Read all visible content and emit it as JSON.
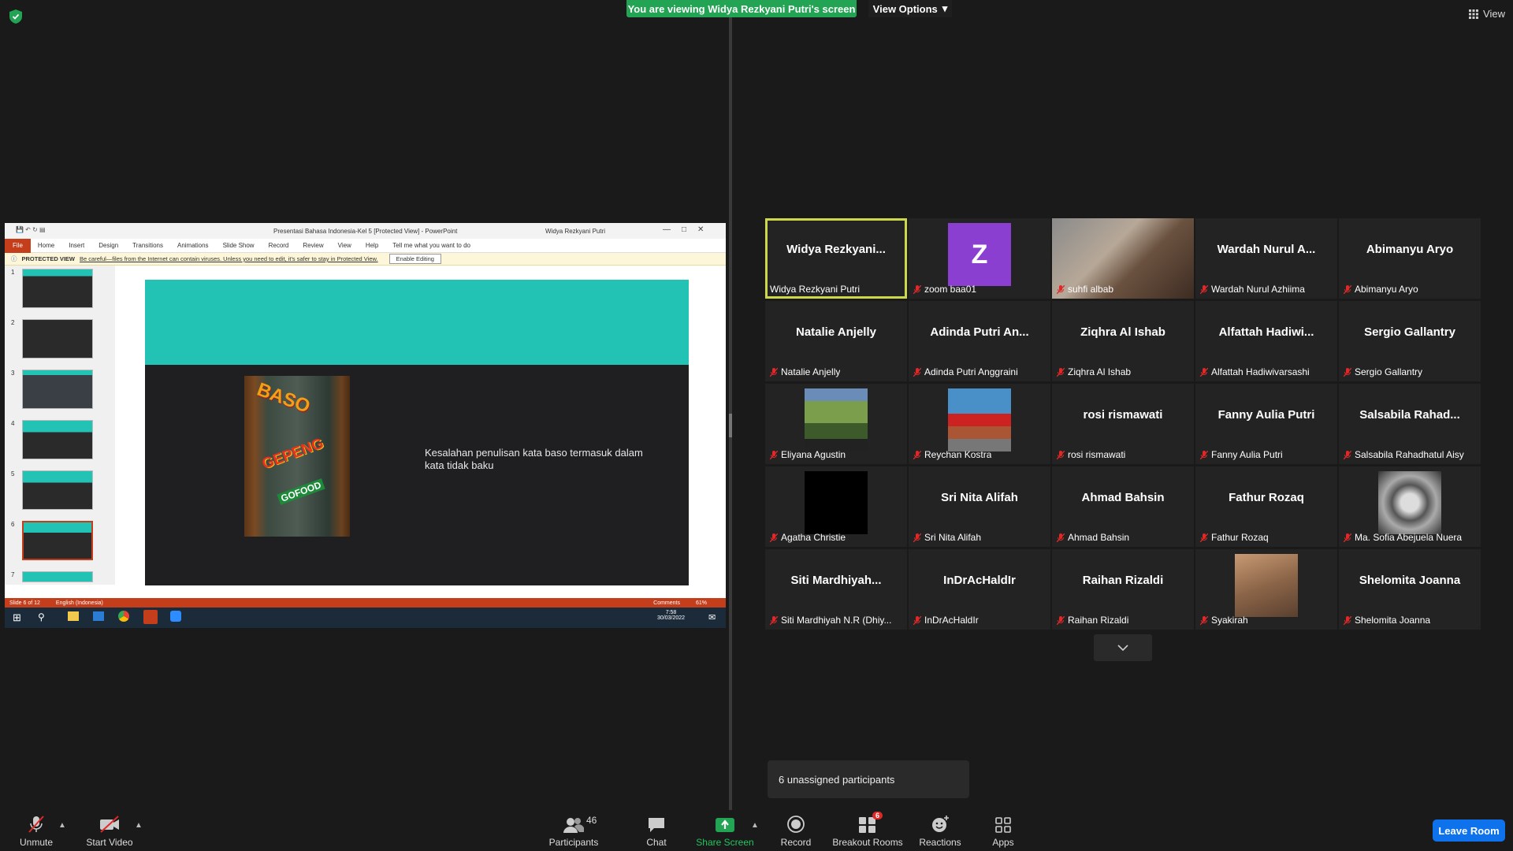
{
  "banner": {
    "sharing_text": "You are viewing Widya Rezkyani Putri's screen",
    "view_options_label": "View Options"
  },
  "view_button": {
    "label": "View"
  },
  "shared_screen": {
    "window_title": "Presentasi Bahasa Indonesia-Kel 5 [Protected View] - PowerPoint",
    "user_name": "Widya Rezkyani Putri",
    "ribbon_tabs": [
      "File",
      "Home",
      "Insert",
      "Design",
      "Transitions",
      "Animations",
      "Slide Show",
      "Record",
      "Review",
      "View",
      "Help"
    ],
    "tell_me": "Tell me what you want to do",
    "protected_label": "PROTECTED VIEW",
    "protected_message": "Be careful—files from the Internet can contain viruses. Unless you need to edit, it's safer to stay in Protected View.",
    "enable_editing": "Enable Editing",
    "thumb_numbers": [
      "1",
      "2",
      "3",
      "4",
      "5",
      "6",
      "7"
    ],
    "slide_text": "Kesalahan penulisan kata baso termasuk dalam kata tidak baku",
    "photo_text_top": "BASO",
    "photo_text_mid": "GEPENG",
    "photo_text_bottom": "GOFOOD",
    "status_slide": "Slide 6 of 12",
    "status_language": "English (Indonesia)",
    "status_comments": "Comments",
    "zoom": "61%",
    "clock_time": "7:58",
    "clock_date": "30/03/2022"
  },
  "participants": [
    {
      "display": "Widya  Rezkyani...",
      "label": "Widya Rezkyani Putri",
      "muted": false,
      "active": true
    },
    {
      "display": "Z",
      "label": "zoom baa01",
      "muted": true,
      "avatar_color": "#8b3fd1"
    },
    {
      "display": "",
      "label": "suhfi albab",
      "muted": true,
      "video": true
    },
    {
      "display": "Wardah  Nurul A...",
      "label": "Wardah Nurul Azhiima",
      "muted": true
    },
    {
      "display": "Abimanyu Aryo",
      "label": "Abimanyu Aryo",
      "muted": true
    },
    {
      "display": "Natalie Anjelly",
      "label": "Natalie Anjelly",
      "muted": true
    },
    {
      "display": "Adinda  Putri  An...",
      "label": "Adinda Putri Anggraini",
      "muted": true
    },
    {
      "display": "Ziqhra Al Ishab",
      "label": "Ziqhra Al Ishab",
      "muted": true
    },
    {
      "display": "Alfattah  Hadiwi...",
      "label": "Alfattah Hadiwivarsashi",
      "muted": true
    },
    {
      "display": "Sergio Gallantry",
      "label": "Sergio Gallantry",
      "muted": true
    },
    {
      "display": "",
      "label": "Eliyana Agustin",
      "muted": true,
      "video": true
    },
    {
      "display": "",
      "label": "Reychan Kostra",
      "muted": true,
      "video": true
    },
    {
      "display": "rosi rismawati",
      "label": "rosi rismawati",
      "muted": true
    },
    {
      "display": "Fanny Aulia Putri",
      "label": "Fanny Aulia Putri",
      "muted": true
    },
    {
      "display": "Salsabila  Rahad...",
      "label": "Salsabila Rahadhatul Aisy",
      "muted": true
    },
    {
      "display": "",
      "label": "Agatha Christie",
      "muted": true,
      "video": true
    },
    {
      "display": "Sri Nita Alifah",
      "label": "Sri Nita Alifah",
      "muted": true
    },
    {
      "display": "Ahmad Bahsin",
      "label": "Ahmad Bahsin",
      "muted": true
    },
    {
      "display": "Fathur Rozaq",
      "label": "Fathur Rozaq",
      "muted": true
    },
    {
      "display": "",
      "label": "Ma. Sofia Abejuela Nuera",
      "muted": true,
      "video": true
    },
    {
      "display": "Siti  Mardhiyah...",
      "label": "Siti Mardhiyah N.R (Dhiy...",
      "muted": true
    },
    {
      "display": "InDrAcHaldIr",
      "label": "InDrAcHaldIr",
      "muted": true
    },
    {
      "display": "Raihan Rizaldi",
      "label": "Raihan Rizaldi",
      "muted": true
    },
    {
      "display": "",
      "label": "Syakirah",
      "muted": true,
      "video": true
    },
    {
      "display": "Shelomita Joanna",
      "label": "Shelomita Joanna",
      "muted": true
    }
  ],
  "unassigned": "6 unassigned participants",
  "toolbar": {
    "unmute": "Unmute",
    "start_video": "Start Video",
    "participants": "Participants",
    "participants_count": "46",
    "chat": "Chat",
    "share_screen": "Share Screen",
    "record": "Record",
    "breakout_rooms": "Breakout Rooms",
    "breakout_badge": "6",
    "reactions": "Reactions",
    "apps": "Apps",
    "leave_room": "Leave Room"
  },
  "colors": {
    "accent_green": "#23a455",
    "active_outline": "#cbd84a",
    "leave_blue": "#0e72ed",
    "mute_red": "#e02828",
    "slide_teal": "#22c2b4"
  }
}
